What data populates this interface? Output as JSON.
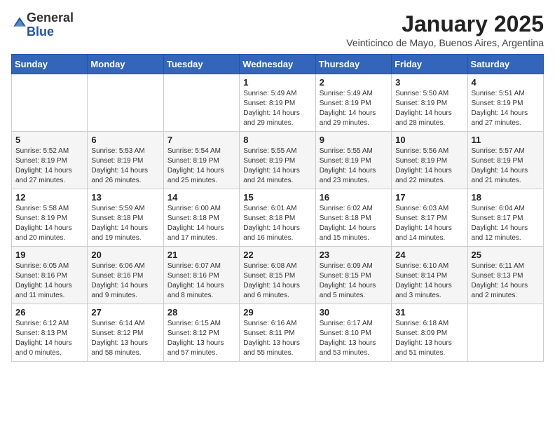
{
  "logo": {
    "general": "General",
    "blue": "Blue"
  },
  "header": {
    "month": "January 2025",
    "subtitle": "Veinticinco de Mayo, Buenos Aires, Argentina"
  },
  "days_of_week": [
    "Sunday",
    "Monday",
    "Tuesday",
    "Wednesday",
    "Thursday",
    "Friday",
    "Saturday"
  ],
  "weeks": [
    [
      {
        "day": "",
        "info": ""
      },
      {
        "day": "",
        "info": ""
      },
      {
        "day": "",
        "info": ""
      },
      {
        "day": "1",
        "info": "Sunrise: 5:49 AM\nSunset: 8:19 PM\nDaylight: 14 hours\nand 29 minutes."
      },
      {
        "day": "2",
        "info": "Sunrise: 5:49 AM\nSunset: 8:19 PM\nDaylight: 14 hours\nand 29 minutes."
      },
      {
        "day": "3",
        "info": "Sunrise: 5:50 AM\nSunset: 8:19 PM\nDaylight: 14 hours\nand 28 minutes."
      },
      {
        "day": "4",
        "info": "Sunrise: 5:51 AM\nSunset: 8:19 PM\nDaylight: 14 hours\nand 27 minutes."
      }
    ],
    [
      {
        "day": "5",
        "info": "Sunrise: 5:52 AM\nSunset: 8:19 PM\nDaylight: 14 hours\nand 27 minutes."
      },
      {
        "day": "6",
        "info": "Sunrise: 5:53 AM\nSunset: 8:19 PM\nDaylight: 14 hours\nand 26 minutes."
      },
      {
        "day": "7",
        "info": "Sunrise: 5:54 AM\nSunset: 8:19 PM\nDaylight: 14 hours\nand 25 minutes."
      },
      {
        "day": "8",
        "info": "Sunrise: 5:55 AM\nSunset: 8:19 PM\nDaylight: 14 hours\nand 24 minutes."
      },
      {
        "day": "9",
        "info": "Sunrise: 5:55 AM\nSunset: 8:19 PM\nDaylight: 14 hours\nand 23 minutes."
      },
      {
        "day": "10",
        "info": "Sunrise: 5:56 AM\nSunset: 8:19 PM\nDaylight: 14 hours\nand 22 minutes."
      },
      {
        "day": "11",
        "info": "Sunrise: 5:57 AM\nSunset: 8:19 PM\nDaylight: 14 hours\nand 21 minutes."
      }
    ],
    [
      {
        "day": "12",
        "info": "Sunrise: 5:58 AM\nSunset: 8:19 PM\nDaylight: 14 hours\nand 20 minutes."
      },
      {
        "day": "13",
        "info": "Sunrise: 5:59 AM\nSunset: 8:18 PM\nDaylight: 14 hours\nand 19 minutes."
      },
      {
        "day": "14",
        "info": "Sunrise: 6:00 AM\nSunset: 8:18 PM\nDaylight: 14 hours\nand 17 minutes."
      },
      {
        "day": "15",
        "info": "Sunrise: 6:01 AM\nSunset: 8:18 PM\nDaylight: 14 hours\nand 16 minutes."
      },
      {
        "day": "16",
        "info": "Sunrise: 6:02 AM\nSunset: 8:18 PM\nDaylight: 14 hours\nand 15 minutes."
      },
      {
        "day": "17",
        "info": "Sunrise: 6:03 AM\nSunset: 8:17 PM\nDaylight: 14 hours\nand 14 minutes."
      },
      {
        "day": "18",
        "info": "Sunrise: 6:04 AM\nSunset: 8:17 PM\nDaylight: 14 hours\nand 12 minutes."
      }
    ],
    [
      {
        "day": "19",
        "info": "Sunrise: 6:05 AM\nSunset: 8:16 PM\nDaylight: 14 hours\nand 11 minutes."
      },
      {
        "day": "20",
        "info": "Sunrise: 6:06 AM\nSunset: 8:16 PM\nDaylight: 14 hours\nand 9 minutes."
      },
      {
        "day": "21",
        "info": "Sunrise: 6:07 AM\nSunset: 8:16 PM\nDaylight: 14 hours\nand 8 minutes."
      },
      {
        "day": "22",
        "info": "Sunrise: 6:08 AM\nSunset: 8:15 PM\nDaylight: 14 hours\nand 6 minutes."
      },
      {
        "day": "23",
        "info": "Sunrise: 6:09 AM\nSunset: 8:15 PM\nDaylight: 14 hours\nand 5 minutes."
      },
      {
        "day": "24",
        "info": "Sunrise: 6:10 AM\nSunset: 8:14 PM\nDaylight: 14 hours\nand 3 minutes."
      },
      {
        "day": "25",
        "info": "Sunrise: 6:11 AM\nSunset: 8:13 PM\nDaylight: 14 hours\nand 2 minutes."
      }
    ],
    [
      {
        "day": "26",
        "info": "Sunrise: 6:12 AM\nSunset: 8:13 PM\nDaylight: 14 hours\nand 0 minutes."
      },
      {
        "day": "27",
        "info": "Sunrise: 6:14 AM\nSunset: 8:12 PM\nDaylight: 13 hours\nand 58 minutes."
      },
      {
        "day": "28",
        "info": "Sunrise: 6:15 AM\nSunset: 8:12 PM\nDaylight: 13 hours\nand 57 minutes."
      },
      {
        "day": "29",
        "info": "Sunrise: 6:16 AM\nSunset: 8:11 PM\nDaylight: 13 hours\nand 55 minutes."
      },
      {
        "day": "30",
        "info": "Sunrise: 6:17 AM\nSunset: 8:10 PM\nDaylight: 13 hours\nand 53 minutes."
      },
      {
        "day": "31",
        "info": "Sunrise: 6:18 AM\nSunset: 8:09 PM\nDaylight: 13 hours\nand 51 minutes."
      },
      {
        "day": "",
        "info": ""
      }
    ]
  ]
}
